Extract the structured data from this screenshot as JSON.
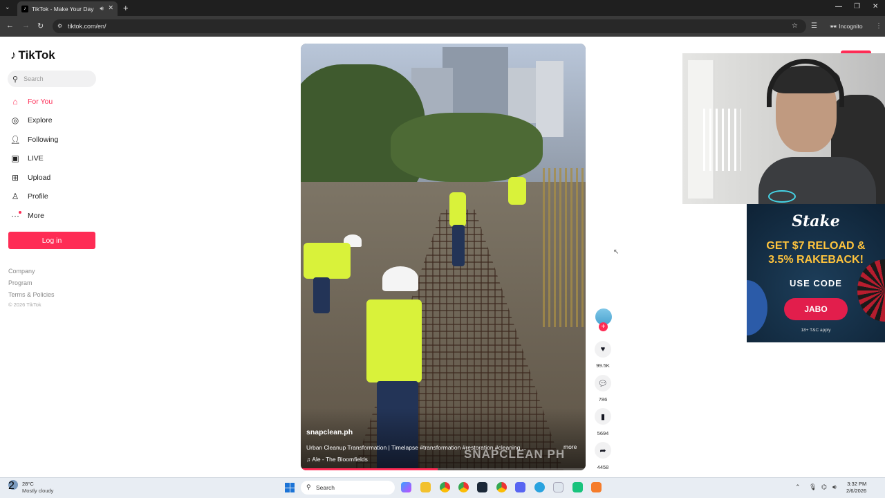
{
  "browser": {
    "tab_title": "TikTok - Make Your Day",
    "url": "tiktok.com/en/",
    "incognito_label": "Incognito"
  },
  "sidebar": {
    "logo": "TikTok",
    "search_placeholder": "Search",
    "items": [
      {
        "label": "For You",
        "icon": "home-icon",
        "active": true
      },
      {
        "label": "Explore",
        "icon": "compass-icon"
      },
      {
        "label": "Following",
        "icon": "following-icon"
      },
      {
        "label": "LIVE",
        "icon": "live-icon"
      },
      {
        "label": "Upload",
        "icon": "upload-icon"
      },
      {
        "label": "Profile",
        "icon": "profile-icon"
      },
      {
        "label": "More",
        "icon": "more-icon"
      }
    ],
    "login_label": "Log in",
    "footer": {
      "company": "Company",
      "program": "Program",
      "terms": "Terms & Policies",
      "copyright": "© 2026 TikTok"
    }
  },
  "video": {
    "username": "snapclean.ph",
    "description": "Urban Cleanup Transformation | Timelapse #transformation #restoration #cleaning ...",
    "more_label": "more",
    "music": "Ale - The Bloomfields",
    "watermark": "SNAPCLEAN PH",
    "progress": 0.48
  },
  "actions": {
    "likes": "99.5K",
    "comments": "786",
    "saves": "5694",
    "shares": "4458"
  },
  "ad": {
    "brand": "Stake",
    "headline_line1": "GET $7 RELOAD &",
    "headline_line2": "3.5% RAKEBACK!",
    "use_code": "USE CODE",
    "code": "JABO",
    "terms": "18+ T&C apply"
  },
  "taskbar": {
    "temperature": "28°C",
    "condition": "Mostly cloudy",
    "weather_badge": "2",
    "search_label": "Search",
    "time": "3:32 PM",
    "date": "2/6/2026"
  },
  "colors": {
    "accent": "#fe2c55",
    "ad_code": "#e21e4c",
    "ad_headline": "#ffc43d"
  }
}
